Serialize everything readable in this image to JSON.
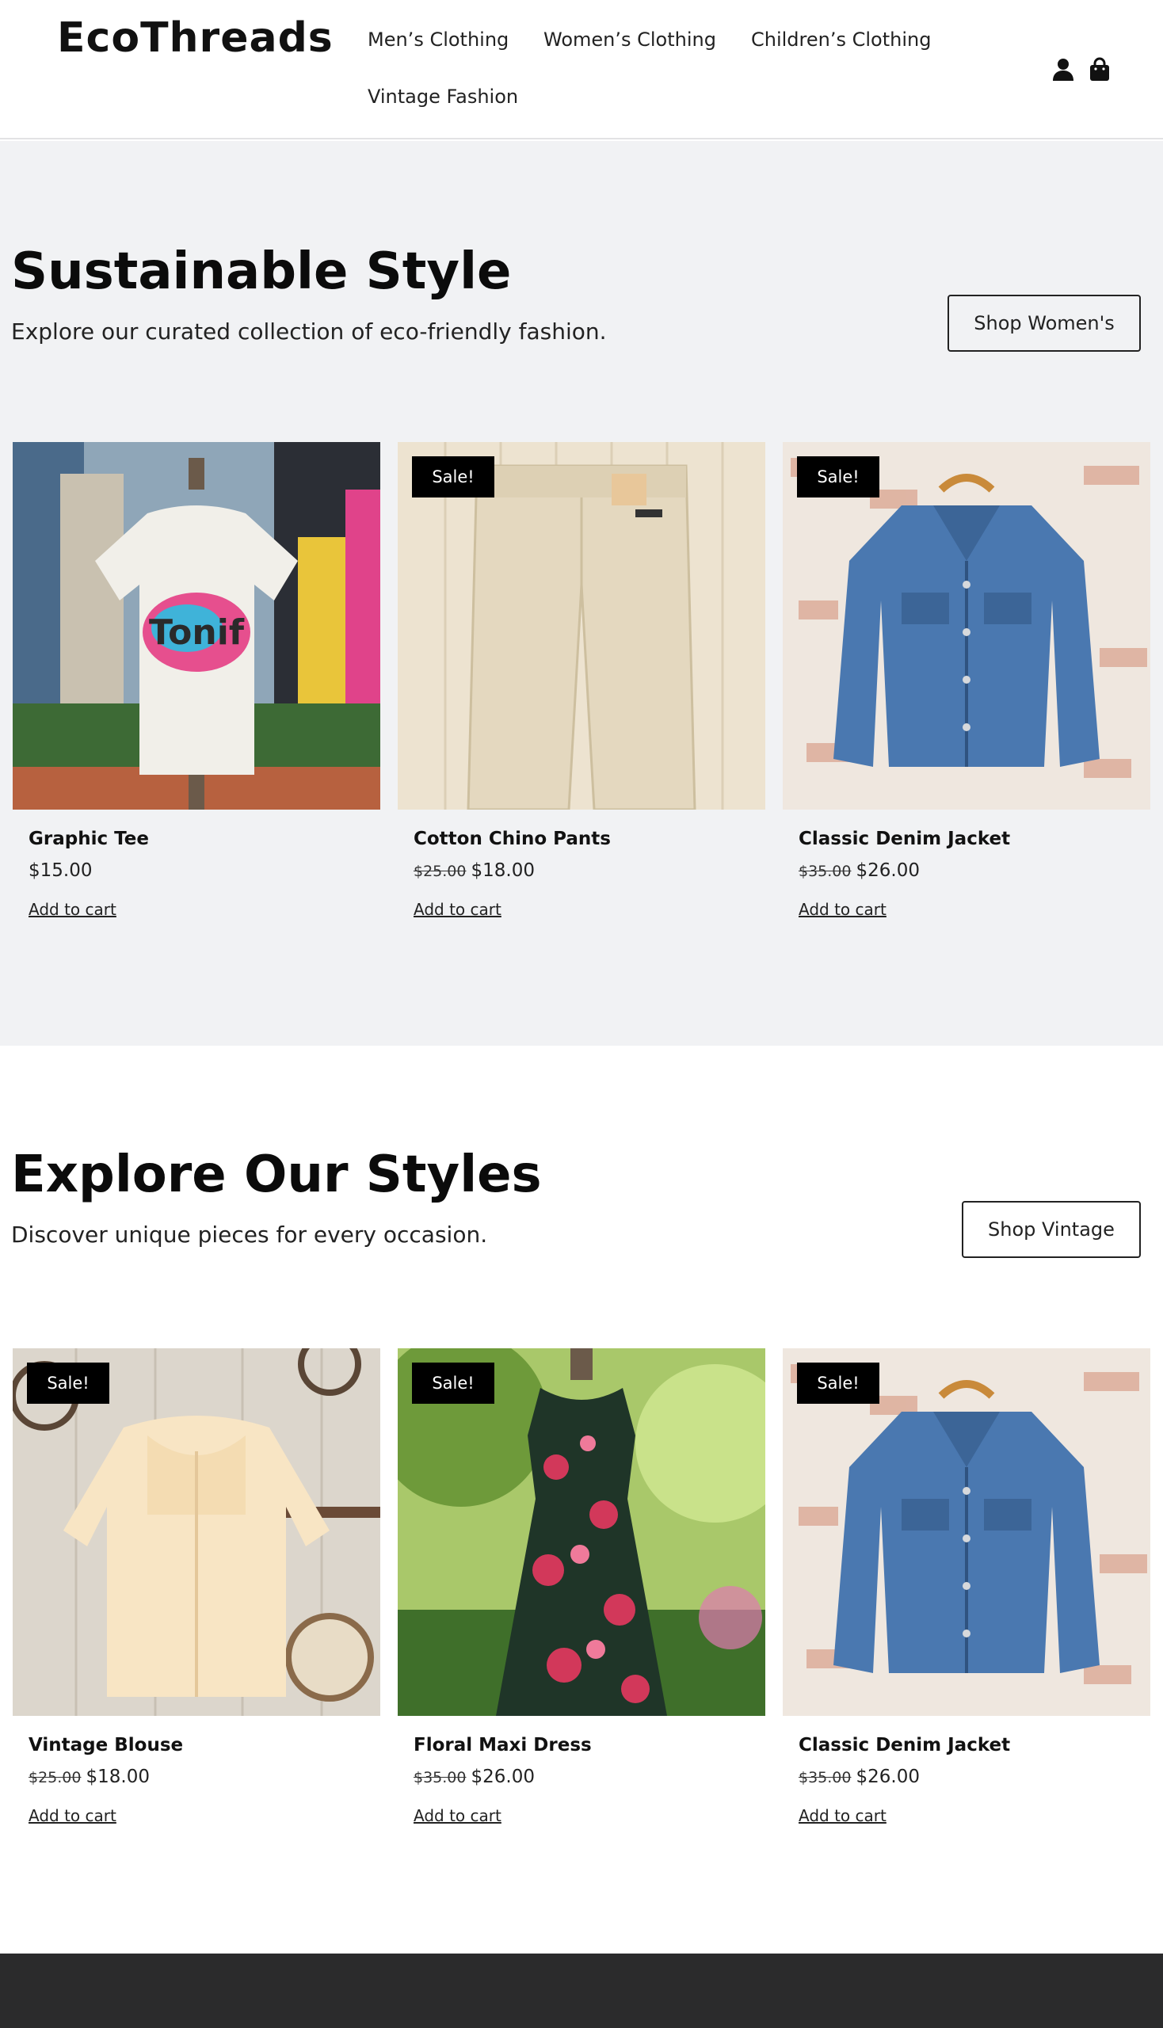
{
  "header": {
    "logo": "EcoThreads",
    "nav": [
      "Men’s Clothing",
      "Women’s Clothing",
      "Children’s Clothing",
      "Vintage Fashion"
    ],
    "icons": [
      "user-icon",
      "shopping-bag-icon"
    ]
  },
  "sections": [
    {
      "title": "Sustainable Style",
      "subtitle": "Explore our curated collection of eco-friendly fashion.",
      "button": "Shop Women's",
      "products": [
        {
          "name": "Graphic Tee",
          "old_price": "",
          "price": "$15.00",
          "sale": false,
          "badge": "",
          "cta": "Add to cart",
          "image": "graphic-tee"
        },
        {
          "name": "Cotton Chino Pants",
          "old_price": "$25.00",
          "price": "$18.00",
          "sale": true,
          "badge": "Sale!",
          "cta": "Add to cart",
          "image": "chino-pants"
        },
        {
          "name": "Classic Denim Jacket",
          "old_price": "$35.00",
          "price": "$26.00",
          "sale": true,
          "badge": "Sale!",
          "cta": "Add to cart",
          "image": "denim-jacket"
        }
      ]
    },
    {
      "title": "Explore Our Styles",
      "subtitle": "Discover unique pieces for every occasion.",
      "button": "Shop Vintage",
      "products": [
        {
          "name": "Vintage Blouse",
          "old_price": "$25.00",
          "price": "$18.00",
          "sale": true,
          "badge": "Sale!",
          "cta": "Add to cart",
          "image": "vintage-blouse"
        },
        {
          "name": "Floral Maxi Dress",
          "old_price": "$35.00",
          "price": "$26.00",
          "sale": true,
          "badge": "Sale!",
          "cta": "Add to cart",
          "image": "floral-dress"
        },
        {
          "name": "Classic Denim Jacket",
          "old_price": "$35.00",
          "price": "$26.00",
          "sale": true,
          "badge": "Sale!",
          "cta": "Add to cart",
          "image": "denim-jacket"
        }
      ]
    }
  ],
  "colors": {
    "section_bg": "#f1f2f4",
    "badge_bg": "#000000",
    "footer_bg": "#2b2b2c",
    "text": "#111111"
  }
}
